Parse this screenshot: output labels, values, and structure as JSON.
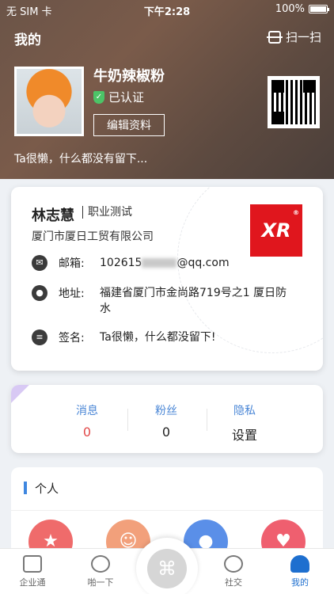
{
  "status_bar": {
    "carrier": "无 SIM 卡",
    "time": "下午2:28",
    "battery": "100%"
  },
  "header": {
    "title": "我的",
    "scan_label": "扫一扫"
  },
  "profile": {
    "nickname": "牛奶辣椒粉",
    "verified_label": "已认证",
    "edit_label": "编辑资料",
    "bio": "Ta很懒，什么都没有留下..."
  },
  "card": {
    "name": "林志慧",
    "job_title": "职业测试",
    "company": "厦门市厦日工贸有限公司",
    "logo_text": "XR",
    "logo_mark": "®",
    "email_key": "邮箱:",
    "email_prefix": "102615",
    "email_suffix": "@qq.com",
    "address_key": "地址:",
    "address_value": "福建省厦门市金尚路719号之1 厦日防水",
    "signature_key": "签名:",
    "signature_value": "Ta很懒，什么都没留下!"
  },
  "stats": [
    {
      "label": "消息",
      "value": "0"
    },
    {
      "label": "粉丝",
      "value": "0"
    },
    {
      "label": "隐私",
      "value": "设置"
    }
  ],
  "personal": {
    "title": "个人"
  },
  "tabs": [
    {
      "label": "企业通"
    },
    {
      "label": "啪一下"
    },
    {
      "label": "社交"
    },
    {
      "label": "我的"
    }
  ],
  "colors": {
    "accent": "#1e6fcf",
    "logo_red": "#e0161d",
    "stat_label": "#4b87d6",
    "badge_green": "#4cc467"
  }
}
